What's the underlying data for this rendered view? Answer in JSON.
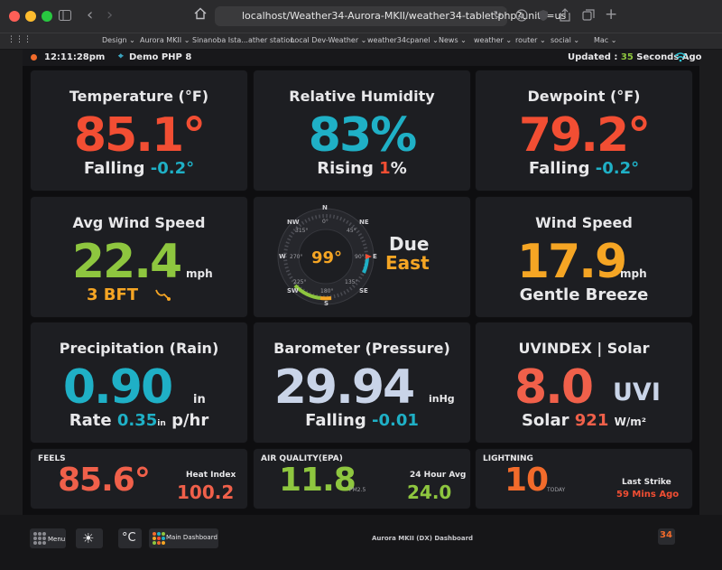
{
  "browser": {
    "url": "localhost/Weather34-Aurora-MKII/weather34-tablet.php?units=us",
    "bookmarks": [
      "Design",
      "Aurora MKII",
      "Sinanoba Ista...ather station",
      "Local Dev-Weather",
      "weather34cpanel",
      "News",
      "weather",
      "router",
      "social",
      "Mac"
    ]
  },
  "status": {
    "time": "12:11:28pm",
    "station": "Demo PHP 8",
    "updated_label": "Updated :",
    "updated_seconds": "35",
    "updated_suffix": "Seconds Ago"
  },
  "temperature": {
    "title": "Temperature (°F)",
    "value": "85.1°",
    "trend": "Falling",
    "change": "-0.2°"
  },
  "humidity": {
    "title": "Relative Humidity",
    "value": "83%",
    "trend": "Rising",
    "change": "1",
    "unit": "%"
  },
  "dewpoint": {
    "title": "Dewpoint (°F)",
    "value": "79.2°",
    "trend": "Falling",
    "change": "-0.2°"
  },
  "avg_wind": {
    "title": "Avg Wind Speed",
    "value": "22.4",
    "unit": "mph",
    "bft": "3 BFT"
  },
  "compass": {
    "direction_value": "99°",
    "direction_line1": "Due",
    "direction_line2": "East",
    "cardinals": [
      "N",
      "NE",
      "E",
      "SE",
      "S",
      "SW",
      "W",
      "NW"
    ],
    "degrees": [
      "0°",
      "45°",
      "90°",
      "135°",
      "180°",
      "225°",
      "270°",
      "315°"
    ]
  },
  "wind_speed": {
    "title": "Wind Speed",
    "value": "17.9",
    "unit": "mph",
    "desc": "Gentle Breeze"
  },
  "precip": {
    "title": "Precipitation (Rain)",
    "value": "0.90",
    "unit": "in",
    "rate_label": "Rate",
    "rate_value": "0.35",
    "rate_unit_small": "in",
    "rate_unit": "p/hr"
  },
  "barometer": {
    "title": "Barometer (Pressure)",
    "value": "29.94",
    "unit": "inHg",
    "trend": "Falling",
    "change": "-0.01"
  },
  "uv": {
    "title": "UVINDEX | Solar",
    "value": "8.0",
    "unit": "UVI",
    "solar_label": "Solar",
    "solar_value": "921",
    "solar_unit": "W/m²"
  },
  "feels": {
    "title": "FEELS",
    "value": "85.6°",
    "hi_label": "Heat Index",
    "hi_value": "100.2"
  },
  "air": {
    "title": "AIR QUALITY(EPA)",
    "value": "11.8",
    "unit": "PM2.5",
    "avg_label": "24 Hour Avg",
    "avg_value": "24.0"
  },
  "lightning": {
    "title": "LIGHTNING",
    "value": "10",
    "unit": "TODAY",
    "last_label": "Last Strike",
    "last_value": "59 Mins Ago"
  },
  "footer": {
    "menu_label": "Menu",
    "celsius_label": "°C",
    "main_dashboard": "Main Dashboard",
    "footer_title": "Aurora MKII (DX) Dashboard",
    "logo_text": "34"
  },
  "colors": {
    "red": "#f24e33",
    "cyan": "#1fb0c6",
    "green": "#8ec63f",
    "orange": "#f5a524",
    "salmon": "#f0604a",
    "blue_light": "#c9d4e8"
  }
}
